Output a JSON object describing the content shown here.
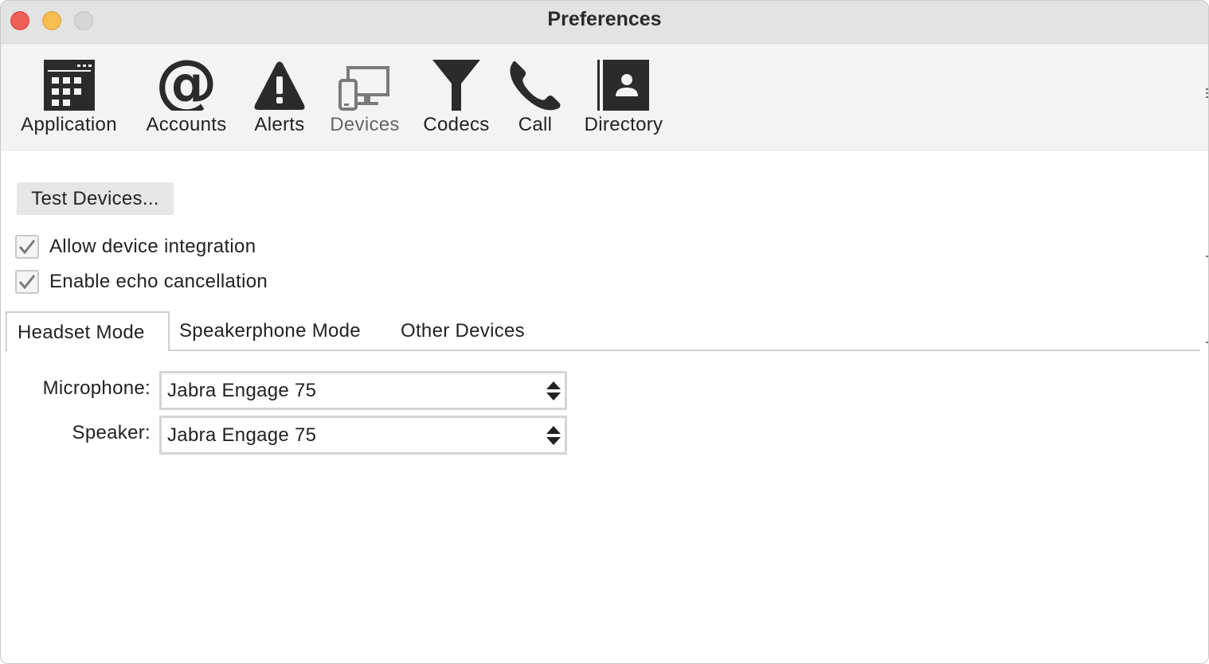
{
  "window": {
    "title": "Preferences"
  },
  "toolbar": {
    "items": [
      {
        "label": "Application",
        "icon": "calendar-grid-icon",
        "active": false
      },
      {
        "label": "Accounts",
        "icon": "at-sign-icon",
        "active": false
      },
      {
        "label": "Alerts",
        "icon": "warning-triangle-icon",
        "active": false
      },
      {
        "label": "Devices",
        "icon": "monitor-phone-icon",
        "active": true
      },
      {
        "label": "Codecs",
        "icon": "funnel-icon",
        "active": false
      },
      {
        "label": "Call",
        "icon": "phone-handset-icon",
        "active": false
      },
      {
        "label": "Directory",
        "icon": "contact-book-icon",
        "active": false
      }
    ]
  },
  "devices": {
    "test_button": "Test Devices...",
    "checkboxes": [
      {
        "label": "Allow device integration",
        "checked": true
      },
      {
        "label": "Enable echo cancellation",
        "checked": true
      }
    ],
    "tabs": [
      {
        "label": "Headset Mode",
        "selected": true
      },
      {
        "label": "Speakerphone Mode",
        "selected": false
      },
      {
        "label": "Other Devices",
        "selected": false
      }
    ],
    "fields": [
      {
        "label": "Microphone:",
        "value": "Jabra Engage 75"
      },
      {
        "label": "Speaker:",
        "value": "Jabra Engage 75"
      }
    ]
  },
  "colors": {
    "close": "#ee5f57",
    "minimize": "#f5be4f",
    "zoom_disabled": "#d6d6d6",
    "icon": "#2b2b2b",
    "icon_active": "#7a7a7a"
  }
}
